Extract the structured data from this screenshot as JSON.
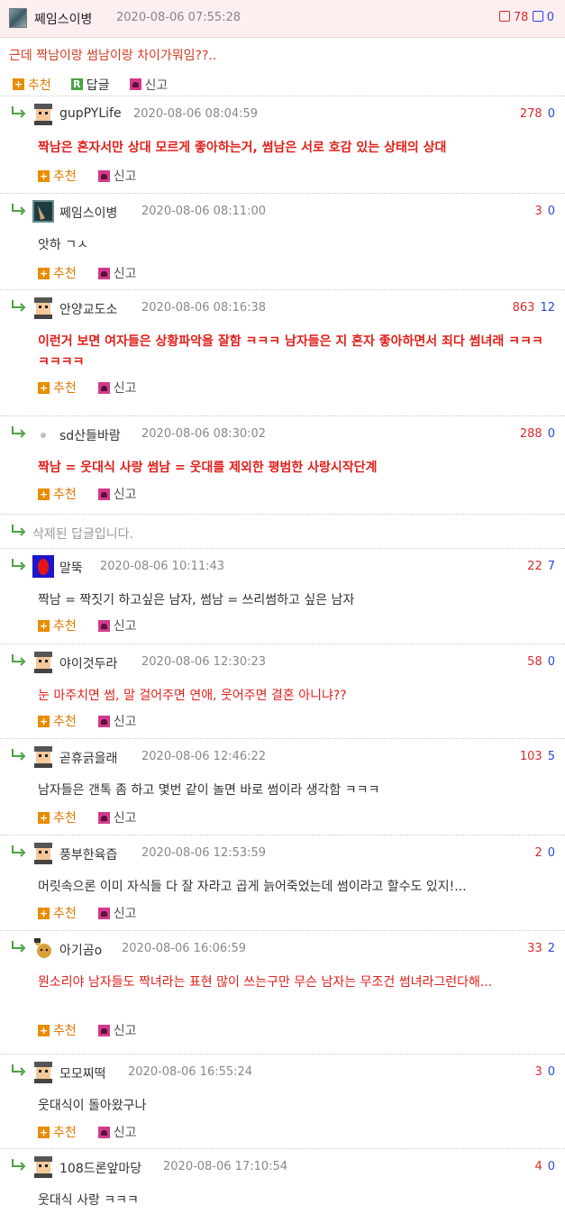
{
  "post": {
    "nickname": "쩨임스이병",
    "time": "2020-08-06 07:55:28",
    "up": "78",
    "down": "0",
    "text": "근데 짝남이랑 썸남이랑 차이가뭐임??..",
    "recommend_label": "추천",
    "reply_label": "답글",
    "report_label": "신고",
    "reply_icon_letter": "R"
  },
  "labels": {
    "recommend": "추천",
    "report": "신고"
  },
  "comments": [
    {
      "nickname": "gupPYLife",
      "time": "2020-08-06 08:04:59",
      "up": "278",
      "down": "0",
      "text": "짝남은 혼자서만 상대 모르게 좋아하는거, 썸남은 서로 호감 있는 상태의 상대",
      "style": "red-bold"
    },
    {
      "nickname": "쩨임스이병",
      "time": "2020-08-06 08:11:00",
      "up": "3",
      "down": "0",
      "text": "앗하 ㄱㅅ",
      "style": "normal"
    },
    {
      "nickname": "안양교도소",
      "time": "2020-08-06 08:16:38",
      "up": "863",
      "down": "12",
      "text": "이런거 보면 여자들은 상황파악을 잘함 ㅋㅋㅋ 남자들은 지 혼자 좋아하면서 죄다 썸녀래 ㅋㅋㅋㅋㅋㅋㅋ",
      "style": "red-bold"
    },
    {
      "nickname": "sd산들바람",
      "time": "2020-08-06 08:30:02",
      "up": "288",
      "down": "0",
      "text": "짝남 = 웃대식 사랑 썸남 = 웃대를 제외한 평범한 사랑시작단계",
      "style": "red-bold"
    },
    {
      "deleted_text": "삭제된 답글입니다."
    },
    {
      "nickname": "말뚝",
      "time": "2020-08-06 10:11:43",
      "up": "22",
      "down": "7",
      "text": "짝남 = 짝짓기 하고싶은 남자, 썸남 = 쓰리썸하고 싶은 남자",
      "style": "normal"
    },
    {
      "nickname": "야이것두라",
      "time": "2020-08-06 12:30:23",
      "up": "58",
      "down": "0",
      "text": "눈 마주치면 썸, 말 걸어주면 연애, 웃어주면 결혼 아니냐??",
      "style": "red"
    },
    {
      "nickname": "곧휴긁을래",
      "time": "2020-08-06 12:46:22",
      "up": "103",
      "down": "5",
      "text": "남자들은 갠톡 좀 하고 몇번 같이 놀면 바로 썸이라 생각함 ㅋㅋㅋ",
      "style": "normal"
    },
    {
      "nickname": "풍부한육즙",
      "time": "2020-08-06 12:53:59",
      "up": "2",
      "down": "0",
      "text": "머릿속으론 이미 자식들 다 잘 자라고 곱게 늙어죽었는데 썸이라고 할수도 있지!...",
      "style": "normal"
    },
    {
      "nickname": "아기곰o",
      "time": "2020-08-06 16:06:59",
      "up": "33",
      "down": "2",
      "text": "뭔소리야 남자들도 짝녀라는 표현 많이 쓰는구만 무슨 남자는 무조건 썸녀라그런다해...",
      "style": "red"
    },
    {
      "nickname": "모모찌떡",
      "time": "2020-08-06 16:55:24",
      "up": "3",
      "down": "0",
      "text": "웃대식이 돌아왔구나",
      "style": "normal"
    },
    {
      "nickname": "108드론앞마당",
      "time": "2020-08-06 17:10:54",
      "up": "4",
      "down": "0",
      "text": "웃대식 사랑 ㅋㅋㅋ",
      "style": "normal"
    }
  ],
  "colors": {
    "up": "#d92b2b",
    "down": "#2b4ad9",
    "red_text": "#e0201b",
    "post_bg": "#fdeef0"
  }
}
